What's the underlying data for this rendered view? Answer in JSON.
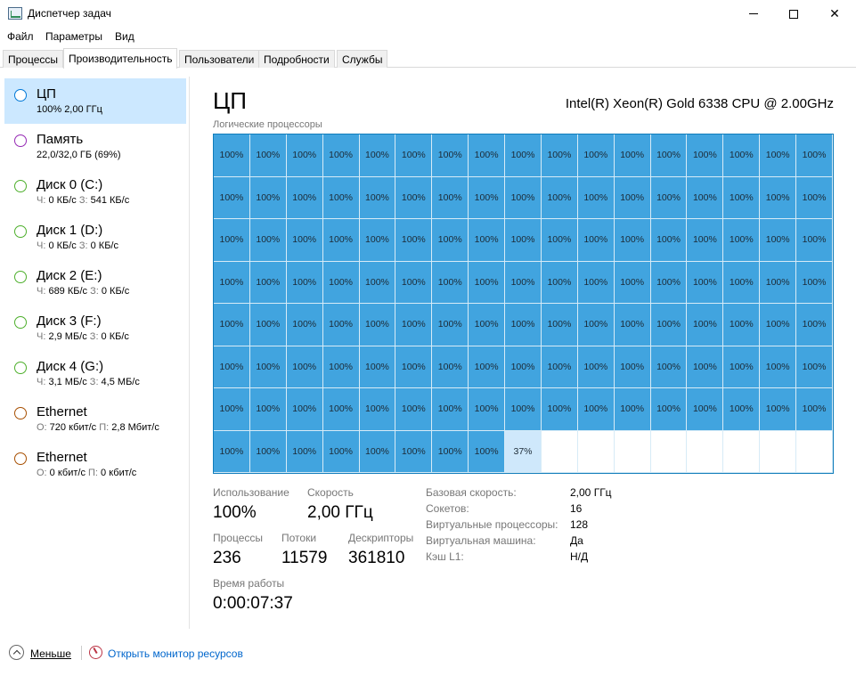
{
  "window": {
    "title": "Диспетчер задач",
    "minimize": "—",
    "maximize": "☐",
    "close": "✕"
  },
  "menu": [
    {
      "label": "Файл"
    },
    {
      "label": "Параметры"
    },
    {
      "label": "Вид"
    }
  ],
  "tabs": [
    {
      "label": "Процессы",
      "active": false
    },
    {
      "label": "Производительность",
      "active": true
    },
    {
      "label": "Пользователи",
      "active": false
    },
    {
      "label": "Подробности",
      "active": false
    },
    {
      "label": "Службы",
      "active": false
    }
  ],
  "sidebar": {
    "items": [
      {
        "name": "ЦП",
        "sub": "100% 2,00 ГГц",
        "color": "#0078d7",
        "selected": true
      },
      {
        "name": "Память",
        "sub": "22,0/32,0 ГБ (69%)",
        "color": "#9528b4",
        "selected": false
      },
      {
        "name": "Диск 0 (C:)",
        "sub_parts": [
          "Ч:",
          " 0 КБ/с ",
          "З:",
          " 541 КБ/с"
        ],
        "color": "#4daf2b",
        "selected": false
      },
      {
        "name": "Диск 1 (D:)",
        "sub_parts": [
          "Ч:",
          " 0 КБ/с ",
          "З:",
          " 0 КБ/с"
        ],
        "color": "#4daf2b",
        "selected": false
      },
      {
        "name": "Диск 2 (E:)",
        "sub_parts": [
          "Ч:",
          " 689 КБ/с ",
          "З:",
          " 0 КБ/с"
        ],
        "color": "#4daf2b",
        "selected": false
      },
      {
        "name": "Диск 3 (F:)",
        "sub_parts": [
          "Ч:",
          " 2,9 МБ/с ",
          "З:",
          " 0 КБ/с"
        ],
        "color": "#4daf2b",
        "selected": false
      },
      {
        "name": "Диск 4 (G:)",
        "sub_parts": [
          "Ч:",
          " 3,1 МБ/с ",
          "З:",
          " 4,5 МБ/с"
        ],
        "color": "#4daf2b",
        "selected": false
      },
      {
        "name": "Ethernet",
        "sub_parts": [
          "О:",
          " 720 кбит/с ",
          "П:",
          " 2,8 Мбит/с"
        ],
        "color": "#a74f01",
        "selected": false
      },
      {
        "name": "Ethernet",
        "sub_parts": [
          "О:",
          " 0 кбит/с ",
          "П:",
          " 0 кбит/с"
        ],
        "color": "#a74f01",
        "selected": false
      }
    ]
  },
  "main": {
    "title": "ЦП",
    "model": "Intel(R) Xeon(R) Gold 6338 CPU @ 2.00GHz",
    "grid_label": "Логические процессоры",
    "processors": {
      "count": 128,
      "full_label": "100%",
      "last_label": "37%",
      "last_fraction": 0.37
    },
    "stats": {
      "usage_label": "Использование",
      "usage_value": "100%",
      "speed_label": "Скорость",
      "speed_value": "2,00 ГГц",
      "processes_label": "Процессы",
      "processes_value": "236",
      "threads_label": "Потоки",
      "threads_value": "11579",
      "handles_label": "Дескрипторы",
      "handles_value": "361810",
      "uptime_label": "Время работы",
      "uptime_value": "0:00:07:37"
    },
    "info": [
      {
        "label": "Базовая скорость:",
        "value": "2,00 ГГц"
      },
      {
        "label": "Сокетов:",
        "value": "16"
      },
      {
        "label": "Виртуальные процессоры:",
        "value": "128"
      },
      {
        "label": "Виртуальная машина:",
        "value": "Да"
      },
      {
        "label": "Кэш L1:",
        "value": "Н/Д"
      }
    ]
  },
  "footer": {
    "less": "Меньше",
    "resmon": "Открыть монитор ресурсов"
  }
}
